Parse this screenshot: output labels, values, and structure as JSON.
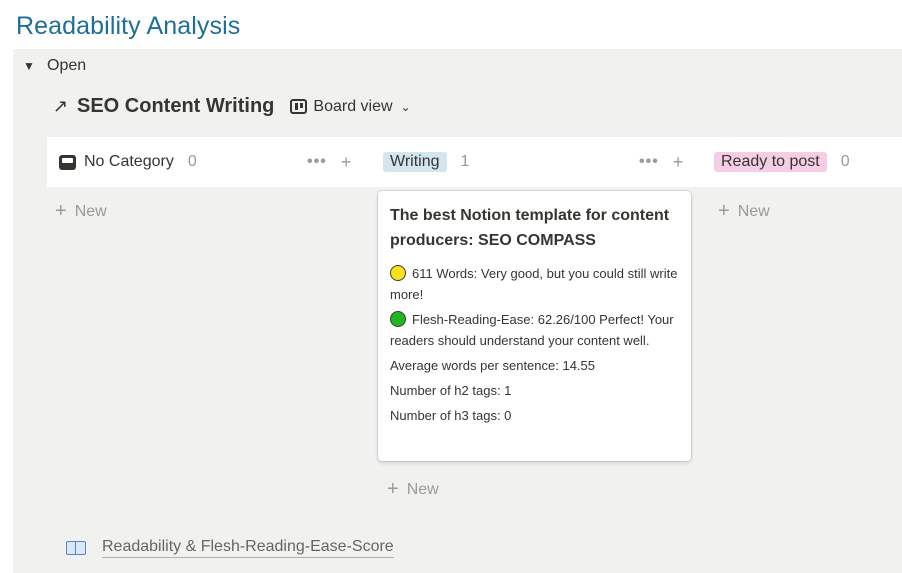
{
  "page": {
    "title": "Readability Analysis"
  },
  "toggle": {
    "label": "Open",
    "arrow": "▼"
  },
  "database": {
    "link_arrow": "↗",
    "title": "SEO Content Writing",
    "view_label": "Board view",
    "view_chevron": "⌄"
  },
  "groups": [
    {
      "label": "No Category",
      "count": "0",
      "icon": "inbox-icon"
    },
    {
      "label": "Writing",
      "count": "1",
      "color": "#d3e5ef"
    },
    {
      "label": "Ready to post",
      "count": "0",
      "color": "#f5cde4"
    }
  ],
  "actions": {
    "more": "•••",
    "add": "+"
  },
  "new_label": "New",
  "card": {
    "title": "The best Notion template for content producers: SEO COMPASS",
    "words": "611 Words:  Very good, but you could still write more!",
    "words_indicator": "yellow",
    "flesh": "Flesh-Reading-Ease: 62.26/100  Perfect! Your readers should understand your content well.",
    "flesh_indicator": "green",
    "avg_words": "Average words per sentence: 14.55",
    "h2": "Number of h2 tags: 1",
    "h3": "Number of h3 tags: 0"
  },
  "footer": {
    "link_text": "Readability & Flesh-Reading-Ease-Score",
    "icon": "book-icon"
  }
}
